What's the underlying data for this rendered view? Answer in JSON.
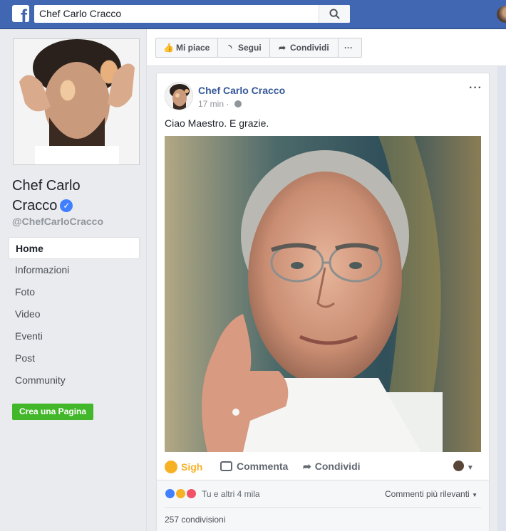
{
  "search": {
    "value": "Chef Carlo Cracco"
  },
  "page": {
    "name_line1": "Chef Carlo",
    "name_line2": "Cracco",
    "handle": "@ChefCarloCracco"
  },
  "nav": {
    "items": [
      "Home",
      "Informazioni",
      "Foto",
      "Video",
      "Eventi",
      "Post",
      "Community"
    ],
    "active": "Home"
  },
  "create_page_label": "Crea una Pagina",
  "actions": {
    "like": "Mi piace",
    "follow": "Segui",
    "share": "Condividi",
    "more": "···"
  },
  "post": {
    "author": "Chef Carlo Cracco",
    "time": "17 min",
    "text": "Ciao Maestro. E grazie.",
    "more": "···",
    "reaction": "Sigh",
    "comment": "Commenta",
    "share": "Condividi",
    "reactions_summary": "Tu e altri 4 mila",
    "comments_filter": "Commenti più rilevanti",
    "shares_count": "257 condivisioni"
  },
  "colors": {
    "brand": "#4267b2",
    "link": "#365899",
    "sigh": "#f7b125",
    "create_btn": "#42b72a"
  }
}
